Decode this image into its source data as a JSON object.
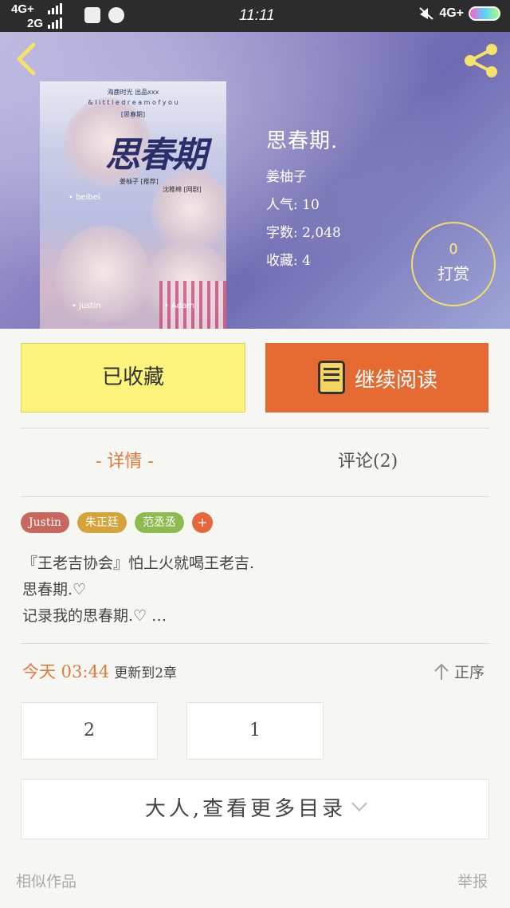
{
  "status_bar": {
    "network_top": "4G+",
    "network_bottom": "2G",
    "time": "11:11",
    "network_right": "4G+"
  },
  "header": {
    "back_icon": "chevron-left-icon",
    "share_icon": "share-icon"
  },
  "cover": {
    "title": "思春期",
    "small_1": "海鹿时光 出品xxx",
    "small_2": "& l i t t l e d r e a m o f y o u",
    "small_3": "[思春期]",
    "sub_1": "姜柚子 [推荐]",
    "sub_2": "沈稚棉 [网剧]",
    "label_1": "• beibei",
    "label_2": "• justin",
    "label_3": "• Adam"
  },
  "book": {
    "title": "思春期.",
    "author": "姜柚子",
    "popularity": "人气: 10",
    "word_count": "字数: 2,048",
    "favorites": "收藏: 4"
  },
  "tip": {
    "count": "0",
    "label": "打赏"
  },
  "actions": {
    "favorited_label": "已收藏",
    "continue_label": "继续阅读"
  },
  "tabs": {
    "detail": "- 详情 -",
    "comments": "评论(2)"
  },
  "tags": [
    {
      "label": "Justin",
      "color": "#c7675e"
    },
    {
      "label": "朱正廷",
      "color": "#d4a43a"
    },
    {
      "label": "范丞丞",
      "color": "#8dbb4f"
    },
    {
      "label": "+",
      "color": "#e6683a"
    }
  ],
  "description": [
    "『王老吉协会』怕上火就喝王老吉.",
    "思春期.♡",
    "记录我的思春期.♡ …"
  ],
  "update": {
    "time": "今天 03:44",
    "text": "更新到2章"
  },
  "sort": {
    "label": "正序",
    "icon": "arrow-up-icon"
  },
  "chapters": [
    "2",
    "1"
  ],
  "more_catalog": "大人,查看更多目录",
  "footer": {
    "similar": "相似作品",
    "report": "举报"
  }
}
